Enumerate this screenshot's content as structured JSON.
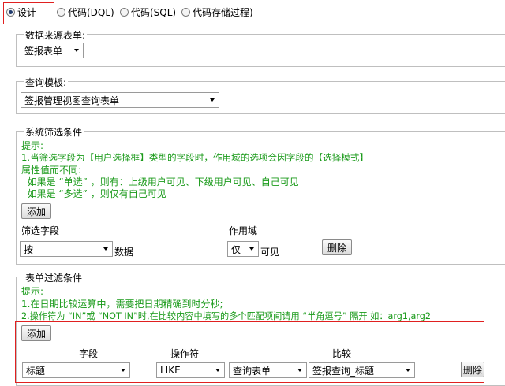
{
  "mode_options": [
    {
      "label": "设计",
      "checked": true
    },
    {
      "label": "代码(DQL)",
      "checked": false
    },
    {
      "label": "代码(SQL)",
      "checked": false
    },
    {
      "label": "代码存储过程)",
      "checked": false
    }
  ],
  "data_source": {
    "legend": "数据来源表单:",
    "selected": "签报表单"
  },
  "query_template": {
    "legend": "查询模板:",
    "selected": "签报管理视图查询表单"
  },
  "system_filter": {
    "legend": "系统筛选条件",
    "tips": [
      "提示:",
      "1.当筛选字段为【用户选择框】类型的字段时，作用域的选项会因字段的【选择模式】",
      "属性值而不同:",
      "  如果是 “单选” ，则有：上级用户可见、下级用户可见、自己可见",
      "  如果是 “多选” ，则仅有自己可见"
    ],
    "add_label": "添加",
    "col_field": "筛选字段",
    "col_scope": "作用域",
    "row": {
      "field_value": "按",
      "suffix": "数据",
      "scope_value": "仅",
      "scope_suffix": "可见",
      "delete_label": "删除"
    }
  },
  "form_filter": {
    "legend": "表单过滤条件",
    "tips": [
      "提示:",
      "1.在日期比较运算中，需要把日期精确到时分秒;",
      "2.操作符为 “IN”或 “NOT IN”时,在比较内容中填写的多个匹配项间请用 “半角逗号” 隔开  如：arg1,arg2"
    ],
    "add_label": "添加",
    "headers": {
      "field": "字段",
      "operator": "操作符",
      "compare": "比较"
    },
    "row": {
      "field": "标题",
      "operator": "LIKE",
      "compare_type": "查询表单",
      "compare_value": "签报查询_标题",
      "delete_label": "删除"
    }
  }
}
